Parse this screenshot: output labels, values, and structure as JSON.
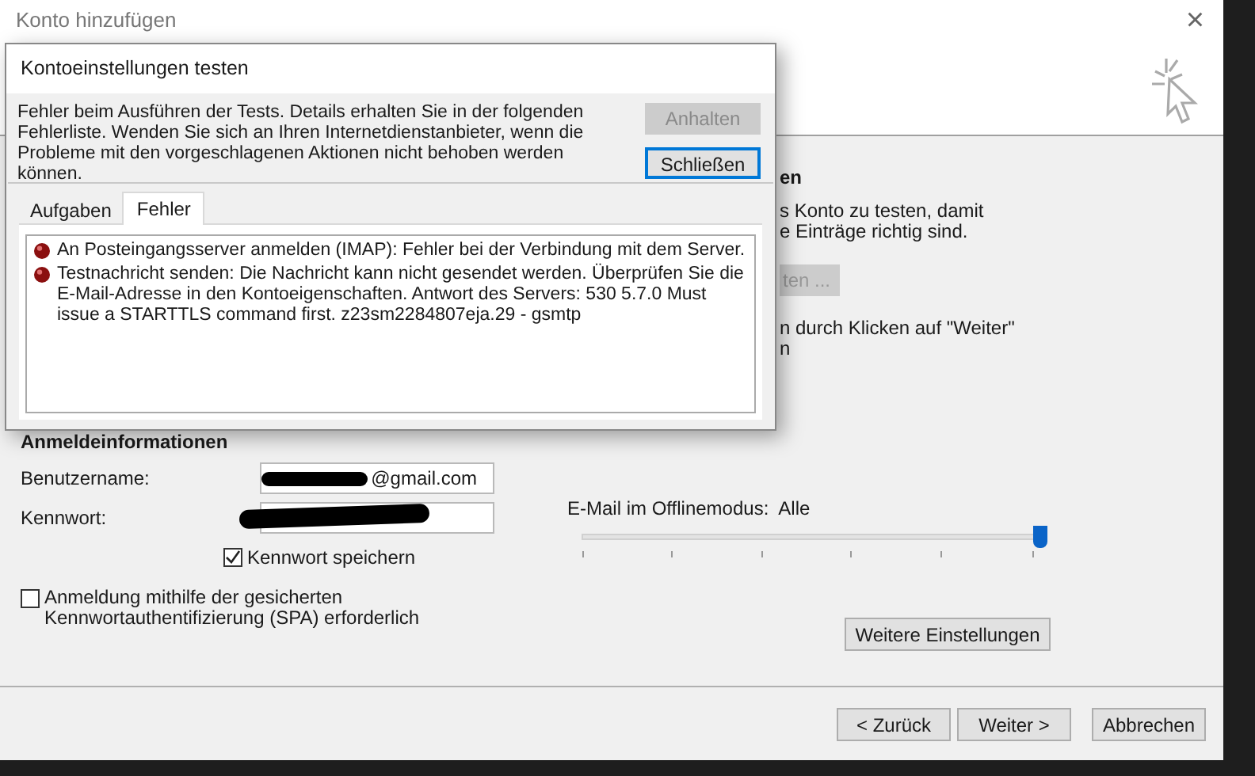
{
  "window": {
    "title": "Konto hinzufügen",
    "close": "×"
  },
  "background_texts": [
    {
      "kind": "heading",
      "text": "en"
    },
    {
      "kind": "text",
      "text": "s Konto zu testen, damit"
    },
    {
      "kind": "text",
      "text": "e Einträge richtig sind."
    },
    {
      "kind": "button",
      "text": "ten ...",
      "disabled": true
    },
    {
      "kind": "text",
      "text": "n durch Klicken auf \"Weiter\""
    },
    {
      "kind": "text",
      "text": "n"
    }
  ],
  "login": {
    "heading": "Anmeldeinformationen",
    "fields": [
      {
        "label": "Benutzername:",
        "value": "@gmail.com",
        "redacted": true
      },
      {
        "label": "Kennwort:",
        "redacted": true
      }
    ],
    "remember": {
      "label": "Kennwort speichern",
      "checked": true
    },
    "spa": {
      "label": "Anmeldung mithilfe der gesicherten Kennwortauthentifizierung (SPA) erforderlich",
      "checked": false
    }
  },
  "offline": {
    "label": "E-Mail im Offlinemodus:",
    "value": "Alle",
    "level": 1
  },
  "more_button": "Weitere Einstellungen",
  "footer_buttons": [
    {
      "label": "< Zurück"
    },
    {
      "label": "Weiter >"
    },
    {
      "label": "Abbrechen"
    }
  ],
  "test_dialog": {
    "title": "Kontoeinstellungen testen",
    "message": "Fehler beim Ausführen der Tests. Details erhalten Sie in der folgenden Fehlerliste. Wenden Sie sich an Ihren Internetdienstanbieter, wenn die Probleme mit den vorgeschlagenen Aktionen nicht behoben werden können.",
    "buttons": [
      {
        "label": "Anhalten",
        "disabled": true,
        "default": false
      },
      {
        "label": "Schließen",
        "disabled": false,
        "default": true
      }
    ],
    "tabs": [
      {
        "label": "Aufgaben",
        "selected": false
      },
      {
        "label": "Fehler",
        "selected": true
      }
    ],
    "errors": [
      {
        "text": "An Posteingangsserver anmelden (IMAP): Fehler bei der Verbindung mit dem Server."
      },
      {
        "text": "Testnachricht senden: Die Nachricht kann nicht gesendet werden. Überprüfen Sie die E-Mail-Adresse in den Kontoeigenschaften. Antwort des Servers: 530 5.7.0 Must issue a STARTTLS command first. z23sm2284807eja.29 - gsmtp"
      }
    ]
  }
}
